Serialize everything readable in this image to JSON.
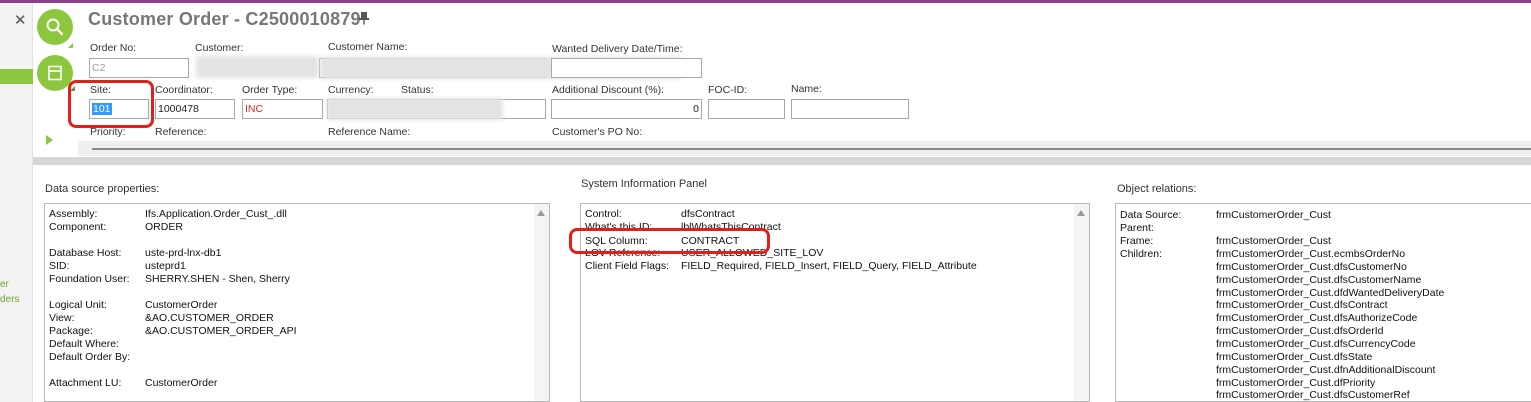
{
  "window": {
    "title": "Customer Order - C2500010879",
    "close_glyph": "✕"
  },
  "left_nav": {
    "partial_1": "er",
    "partial_2": "ders"
  },
  "icons": {
    "search": "search-icon",
    "save": "save-icon",
    "pin": "pin-icon",
    "expand": "play-arrow-icon"
  },
  "header_fields": {
    "order_no": {
      "label": "Order No:",
      "value": "C2"
    },
    "customer": {
      "label": "Customer:"
    },
    "customer_name": {
      "label": "Customer Name:"
    },
    "wanted_delivery": {
      "label": "Wanted Delivery Date/Time:",
      "value": ""
    },
    "site": {
      "label": "Site:",
      "value": "101"
    },
    "coordinator": {
      "label": "Coordinator:",
      "value": "1000478"
    },
    "order_type": {
      "label": "Order Type:",
      "value": "INC"
    },
    "currency": {
      "label": "Currency:"
    },
    "status": {
      "label": "Status:"
    },
    "additional_discount": {
      "label": "Additional Discount (%):",
      "value": "0"
    },
    "foc_id": {
      "label": "FOC-ID:",
      "value": ""
    },
    "name": {
      "label": "Name:",
      "value": ""
    },
    "priority": {
      "label": "Priority:"
    },
    "reference": {
      "label": "Reference:"
    },
    "reference_name": {
      "label": "Reference Name:"
    },
    "customers_po": {
      "label": "Customer's PO No:"
    }
  },
  "data_source": {
    "title": "Data source properties:",
    "rows": [
      {
        "k": "Assembly:",
        "v": "Ifs.Application.Order_Cust_.dll"
      },
      {
        "k": "Component:",
        "v": "ORDER"
      },
      {
        "k": "Database Host:",
        "v": "uste-prd-lnx-db1"
      },
      {
        "k": "SID:",
        "v": "usteprd1"
      },
      {
        "k": "Foundation User:",
        "v": "SHERRY.SHEN - Shen, Sherry"
      },
      {
        "k": "Logical Unit:",
        "v": "CustomerOrder"
      },
      {
        "k": "View:",
        "v": "&AO.CUSTOMER_ORDER"
      },
      {
        "k": "Package:",
        "v": "&AO.CUSTOMER_ORDER_API"
      },
      {
        "k": "Default Where:",
        "v": ""
      },
      {
        "k": "Default Order By:",
        "v": ""
      },
      {
        "k": "Attachment LU:",
        "v": "CustomerOrder"
      }
    ]
  },
  "system_info": {
    "title": "System Information Panel",
    "rows": [
      {
        "k": "Control:",
        "v": "dfsContract"
      },
      {
        "k": "What's this ID:",
        "v": "lblWhatsThisContract"
      },
      {
        "k": "SQL Column:",
        "v": "CONTRACT"
      },
      {
        "k": "LOV Reference:",
        "v": "USER_ALLOWED_SITE_LOV"
      },
      {
        "k": "Client Field Flags:",
        "v": "FIELD_Required, FIELD_Insert, FIELD_Query, FIELD_Attribute"
      }
    ]
  },
  "object_relations": {
    "title": "Object relations:",
    "data_source": {
      "k": "Data Source:",
      "v": "frmCustomerOrder_Cust"
    },
    "parent": {
      "k": "Parent:",
      "v": ""
    },
    "frame": {
      "k": "Frame:",
      "v": "frmCustomerOrder_Cust"
    },
    "children_label": "Children:",
    "children": [
      "frmCustomerOrder_Cust.ecmbsOrderNo",
      "frmCustomerOrder_Cust.dfsCustomerNo",
      "frmCustomerOrder_Cust.dfsCustomerName",
      "frmCustomerOrder_Cust.dfdWantedDeliveryDate",
      "frmCustomerOrder_Cust.dfsContract",
      "frmCustomerOrder_Cust.dfsAuthorizeCode",
      "frmCustomerOrder_Cust.dfsOrderId",
      "frmCustomerOrder_Cust.dfsCurrencyCode",
      "frmCustomerOrder_Cust.dfsState",
      "frmCustomerOrder_Cust.dfnAdditionalDiscount",
      "frmCustomerOrder_Cust.dfPriority",
      "frmCustomerOrder_Cust.dfsCustomerRef"
    ]
  },
  "colors": {
    "accent_green": "#8dc63f",
    "highlight_red": "#e0211a",
    "top_bar": "#8a3e8c",
    "order_type_text": "#d12b2b",
    "selection_blue": "#3399ff"
  }
}
